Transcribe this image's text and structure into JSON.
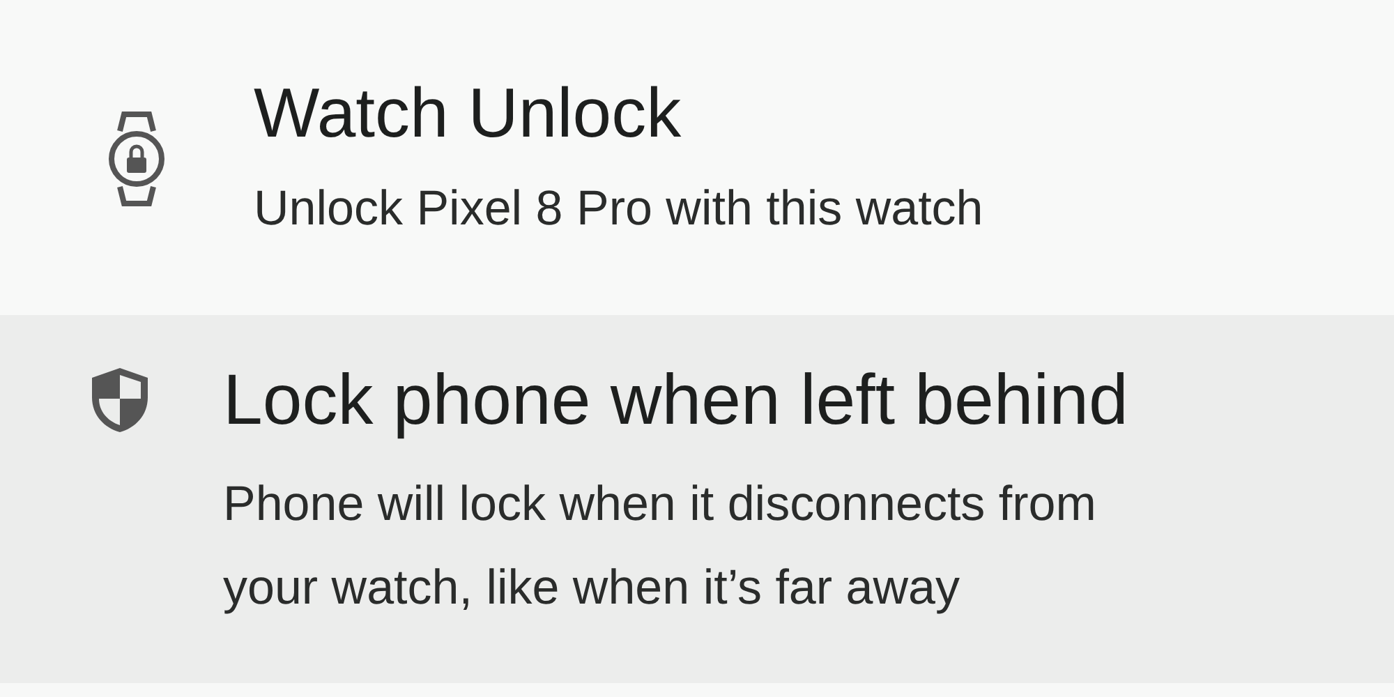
{
  "settings": [
    {
      "kind": "watch",
      "title": "Watch Unlock",
      "summary": "Unlock Pixel 8 Pro with this watch",
      "selected": false
    },
    {
      "kind": "shield",
      "title": "Lock phone when left behind",
      "summary": "Phone will lock when it disconnects from your watch, like when it’s far away",
      "selected": true
    }
  ]
}
